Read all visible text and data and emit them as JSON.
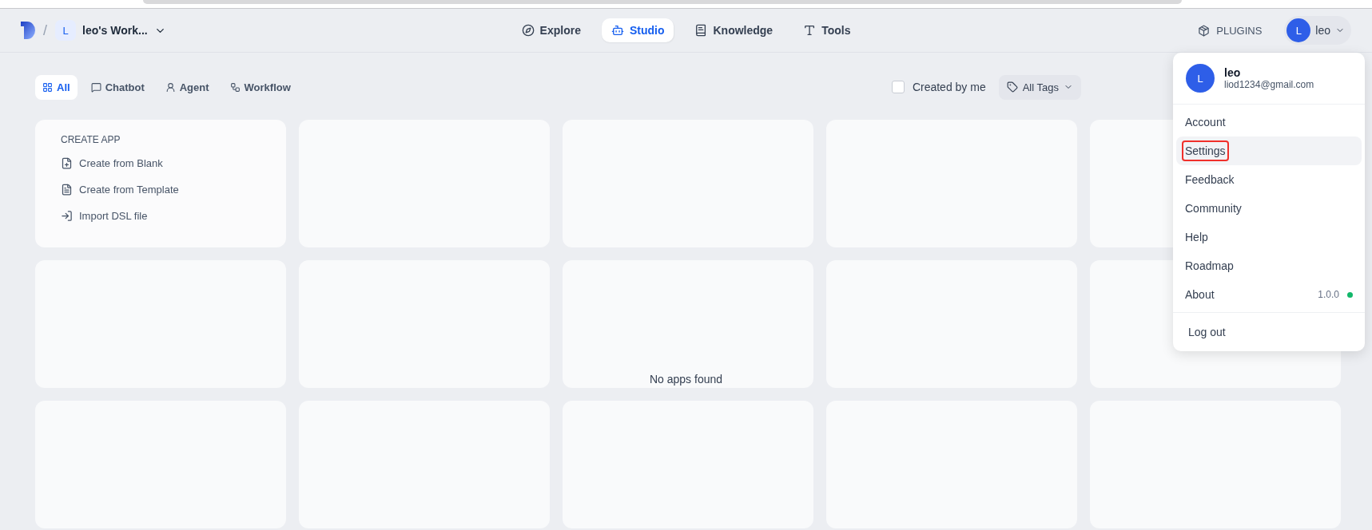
{
  "separator": "/",
  "workspace": {
    "initial": "L",
    "name": "leo's Work..."
  },
  "nav": [
    {
      "label": "Explore",
      "kind": "explore",
      "selected": false
    },
    {
      "label": "Studio",
      "kind": "studio",
      "selected": true
    },
    {
      "label": "Knowledge",
      "kind": "knowledge",
      "selected": false
    },
    {
      "label": "Tools",
      "kind": "tools",
      "selected": false
    }
  ],
  "plugins": "PLUGINS",
  "user": {
    "initial": "L",
    "name": "leo"
  },
  "filters": [
    {
      "label": "All",
      "kind": "all",
      "selected": true
    },
    {
      "label": "Chatbot",
      "kind": "chatbot",
      "selected": false
    },
    {
      "label": "Agent",
      "kind": "agent",
      "selected": false
    },
    {
      "label": "Workflow",
      "kind": "workflow",
      "selected": false
    }
  ],
  "created_by_me": {
    "label": "Created by me",
    "checked": false
  },
  "tags": "All Tags",
  "create_app": {
    "title": "CREATE APP",
    "items": [
      {
        "label": "Create from Blank",
        "kind": "blank"
      },
      {
        "label": "Create from Template",
        "kind": "template"
      },
      {
        "label": "Import DSL file",
        "kind": "import"
      }
    ]
  },
  "empty_message": "No apps found",
  "menu": {
    "name": "leo",
    "email": "liod1234@gmail.com",
    "initial": "L",
    "items": [
      {
        "label": "Account",
        "hovered": false,
        "outlined": false
      },
      {
        "label": "Settings",
        "hovered": true,
        "outlined": true
      },
      {
        "label": "Feedback",
        "hovered": false,
        "outlined": false
      },
      {
        "label": "Community",
        "hovered": false,
        "outlined": false
      },
      {
        "label": "Help",
        "hovered": false,
        "outlined": false
      },
      {
        "label": "Roadmap",
        "hovered": false,
        "outlined": false
      },
      {
        "label": "About",
        "hovered": false,
        "outlined": false,
        "version": "1.0.0",
        "color": "#12b76a"
      }
    ],
    "logout": "Log out"
  }
}
